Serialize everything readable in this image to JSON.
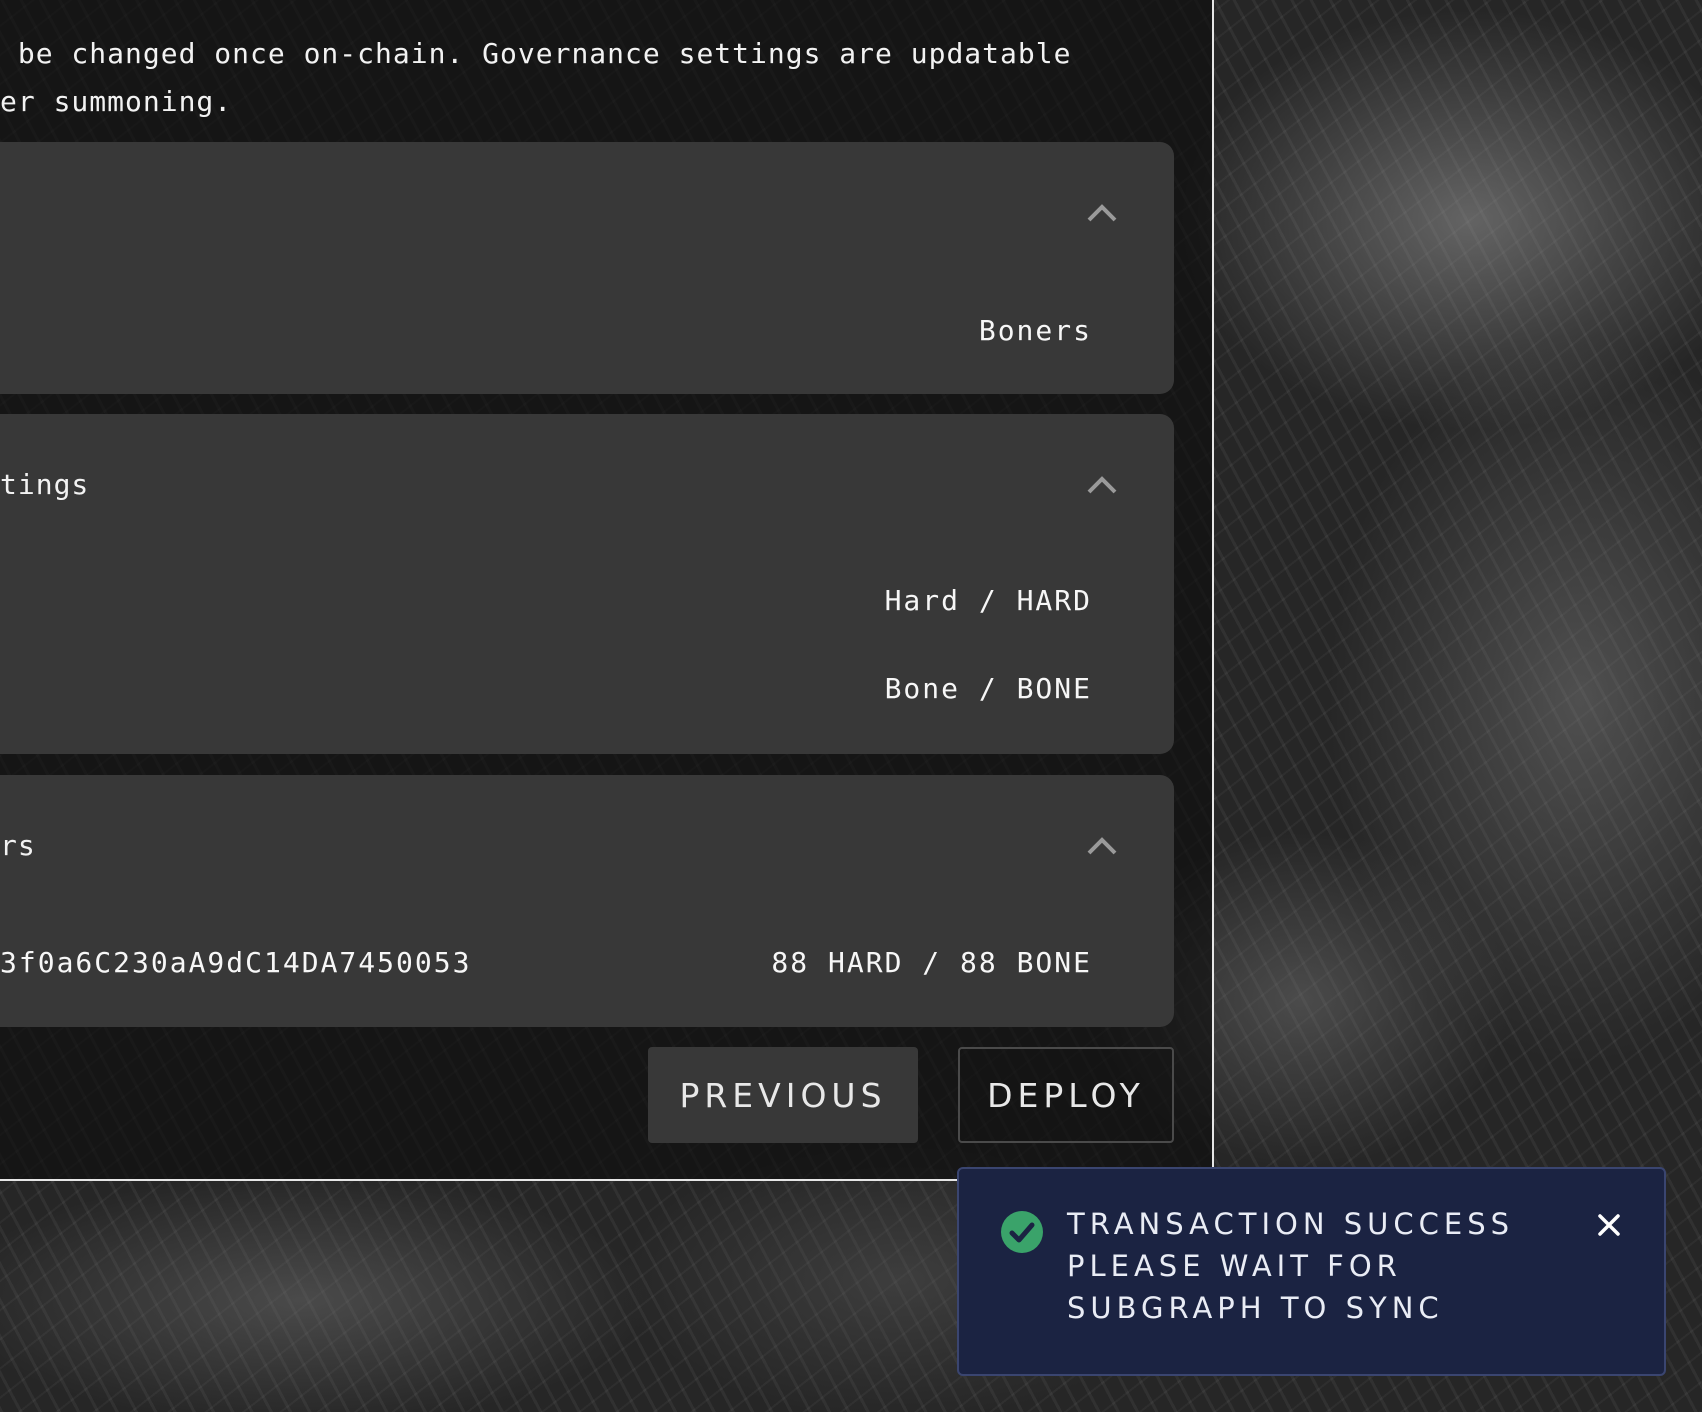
{
  "intro": {
    "line1": " be changed once on-chain. Governance settings are updatable",
    "line2": "er summoning."
  },
  "card_basics": {
    "name_value": "Boners"
  },
  "card_token": {
    "title": "tings",
    "voting_token_value": "Hard / HARD",
    "nontransfer_token_value": "Bone / BONE"
  },
  "card_members": {
    "title": "rs",
    "member_address": "3f0a6C230aA9dC14DA7450053",
    "member_shares": "88 HARD / 88 BONE"
  },
  "actions": {
    "previous_label": "PREVIOUS",
    "deploy_label": "DEPLOY"
  },
  "toast": {
    "message": "Transaction Success Please wait for subgraph to sync",
    "icon": "check-circle-icon",
    "close_icon": "close-icon",
    "success_color": "#3aa36a",
    "background_color": "#1b2342"
  }
}
